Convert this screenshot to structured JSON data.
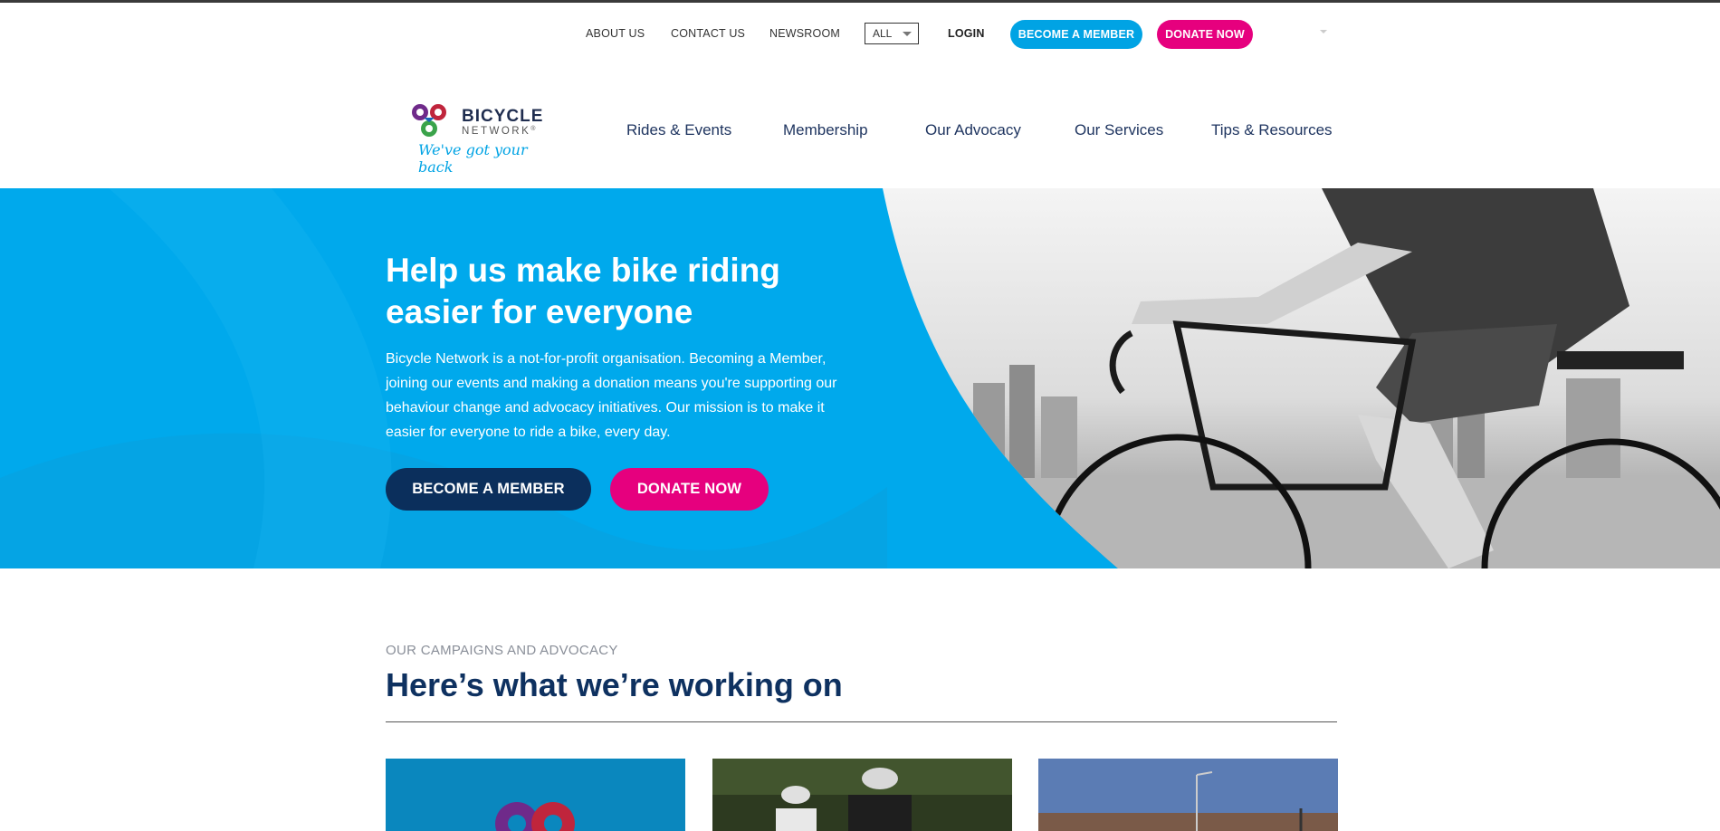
{
  "utility": {
    "about": "ABOUT US",
    "contact": "CONTACT US",
    "newsroom": "NEWSROOM",
    "search_scope": "ALL",
    "login": "LOGIN",
    "become_member": "BECOME A MEMBER",
    "donate": "DONATE NOW"
  },
  "brand": {
    "name_line1": "BICYCLE",
    "name_line2": "NETWORK",
    "trademark": "®",
    "tagline": "We've got your back"
  },
  "nav": {
    "items": [
      "Rides & Events",
      "Membership",
      "Our Advocacy",
      "Our Services",
      "Tips & Resources"
    ]
  },
  "hero": {
    "title_line1": "Help us make bike riding",
    "title_line2": "easier for everyone",
    "body": "Bicycle Network is a not-for-profit organisation. Becoming a Member, joining our events and making a donation means you're supporting our behaviour change and advocacy initiatives. Our mission is to make it easier for everyone to ride a bike, every day.",
    "member_button": "BECOME A MEMBER",
    "donate_button": "DONATE NOW"
  },
  "campaigns": {
    "eyebrow": "OUR CAMPAIGNS AND ADVOCACY",
    "title": "Here’s what we’re working on"
  },
  "colors": {
    "brand_blue": "#00a9ec",
    "brand_pink": "#e6007e",
    "navy": "#0b2f5c"
  }
}
